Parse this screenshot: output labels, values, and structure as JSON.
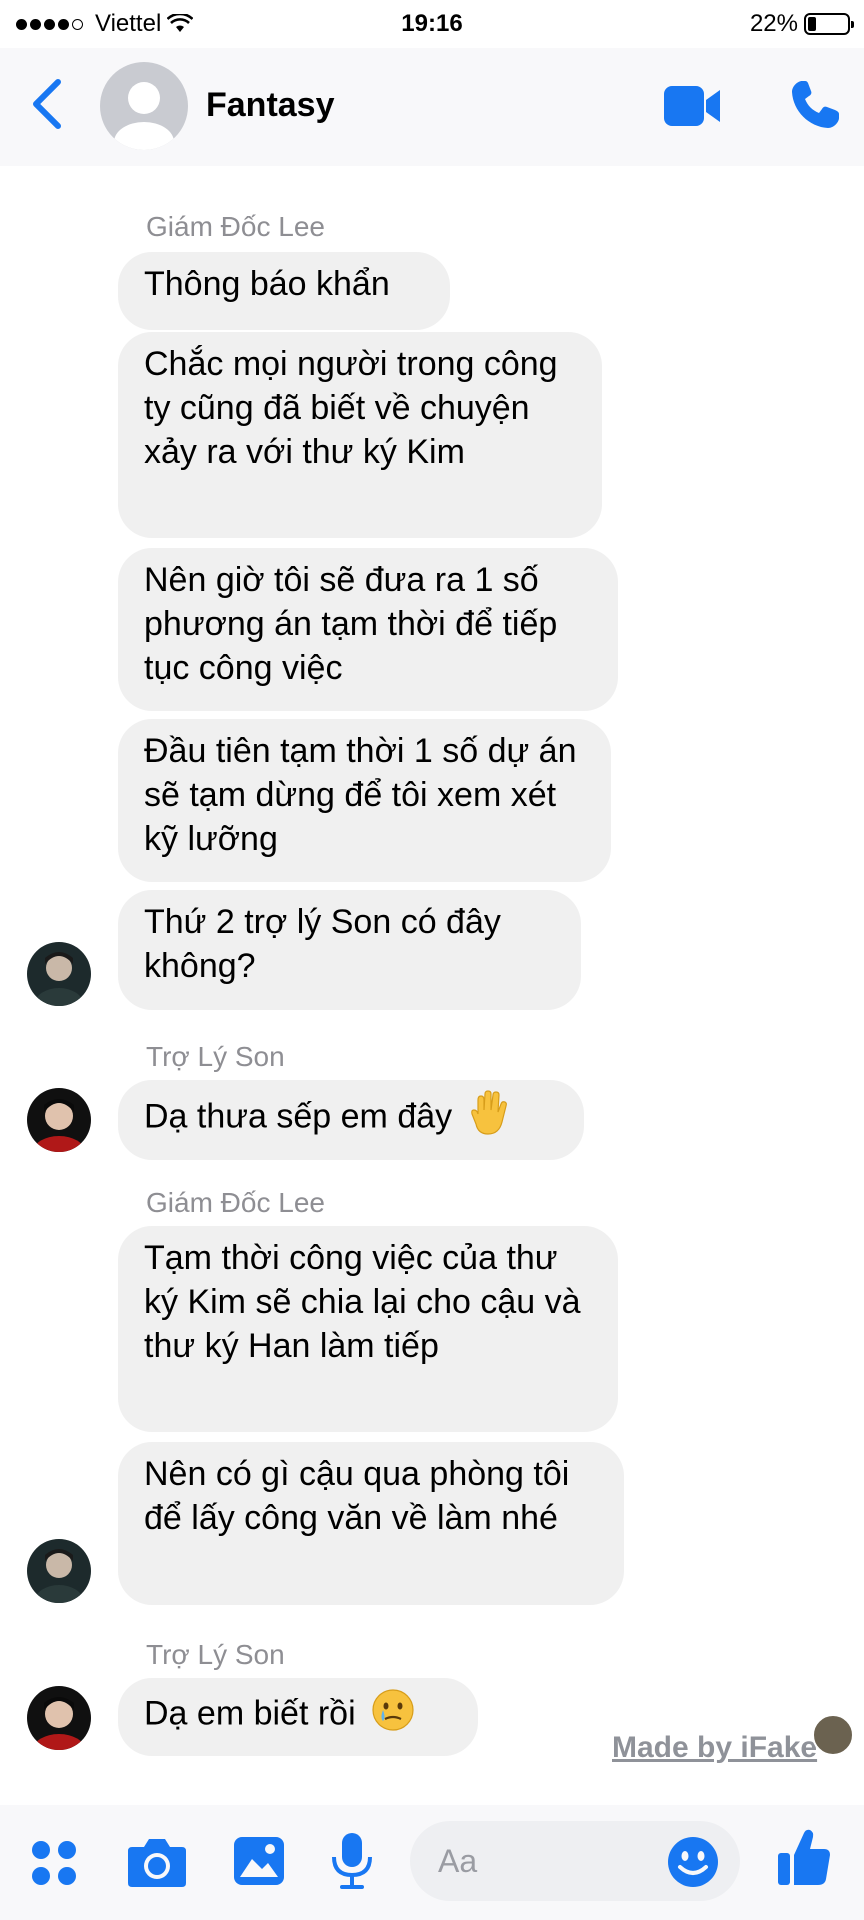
{
  "status_bar": {
    "carrier": "Viettel",
    "time": "19:16",
    "battery": "22%"
  },
  "header": {
    "contact_name": "Fantasy"
  },
  "messages": [
    {
      "sender": "Giám Đốc Lee",
      "texts": [
        "Thông báo khẩn",
        "Chắc mọi người trong công ty cũng đã biết về chuyện xảy ra với thư ký Kim",
        "Nên giờ tôi sẽ đưa ra 1 số phương án tạm thời để tiếp tục công việc",
        "Đầu tiên tạm thời 1 số dự án sẽ tạm dừng để tôi xem xét kỹ lưỡng",
        "Thứ 2 trợ lý Son có đây không?"
      ]
    },
    {
      "sender": "Trợ Lý Son",
      "texts": [
        "Dạ thưa sếp em đây"
      ]
    },
    {
      "sender": "Giám Đốc Lee",
      "texts": [
        "Tạm thời công việc của thư ký Kim sẽ chia lại cho cậu và thư ký Han làm tiếp",
        "Nên có gì cậu qua phòng tôi để lấy công văn về làm nhé"
      ]
    },
    {
      "sender": "Trợ Lý Son",
      "texts": [
        "Dạ em biết rồi"
      ]
    }
  ],
  "watermark": "Made by iFake",
  "composer": {
    "placeholder": "Aa"
  },
  "icons": [
    "back-chevron-icon",
    "video-call-icon",
    "phone-icon",
    "apps-icon",
    "camera-icon",
    "gallery-icon",
    "microphone-icon",
    "emoji-icon",
    "like-icon"
  ],
  "colors": {
    "accent": "#1877F2",
    "bubble": "#F0F0F0",
    "sender_label": "#8E8E93"
  }
}
